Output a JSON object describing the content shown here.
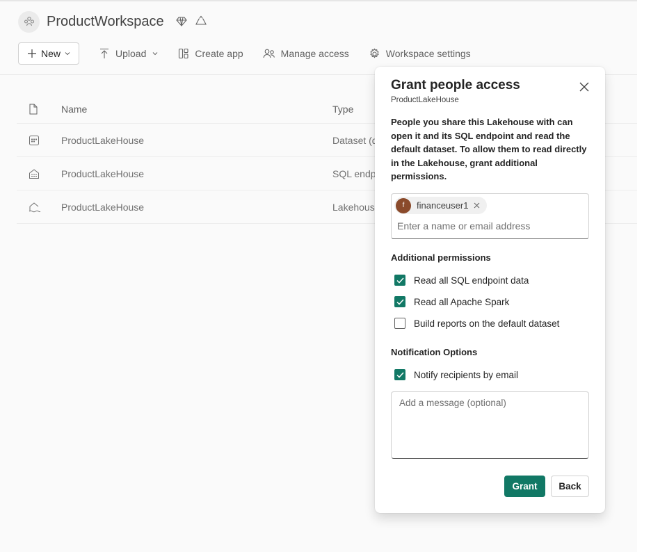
{
  "workspace": {
    "title": "ProductWorkspace",
    "icons": [
      "workspace-avatar-icon",
      "premium-diamond-icon",
      "recycle-icon"
    ]
  },
  "toolbar": {
    "new_label": "New",
    "upload_label": "Upload",
    "create_app_label": "Create app",
    "manage_access_label": "Manage access",
    "workspace_settings_label": "Workspace settings"
  },
  "table": {
    "columns": {
      "name": "Name",
      "type": "Type"
    },
    "rows": [
      {
        "icon": "dataset-icon",
        "name": "ProductLakeHouse",
        "type": "Dataset (d"
      },
      {
        "icon": "sql-endpoint-icon",
        "name": "ProductLakeHouse",
        "type": "SQL endpo"
      },
      {
        "icon": "lakehouse-icon",
        "name": "ProductLakeHouse",
        "type": "Lakehouse"
      }
    ]
  },
  "dialog": {
    "title": "Grant people access",
    "subtitle": "ProductLakeHouse",
    "description": "People you share this Lakehouse with can open it and its SQL endpoint and read the default dataset. To allow them to read directly in the Lakehouse, grant additional permissions.",
    "recipient": {
      "initial": "f",
      "name": "financeuser1"
    },
    "people_placeholder": "Enter a name or email address",
    "additional_permissions_label": "Additional permissions",
    "permissions": [
      {
        "label": "Read all SQL endpoint data",
        "checked": true
      },
      {
        "label": "Read all Apache Spark",
        "checked": true
      },
      {
        "label": "Build reports on the default dataset",
        "checked": false
      }
    ],
    "notification_label": "Notification Options",
    "notify": {
      "label": "Notify recipients by email",
      "checked": true
    },
    "message_placeholder": "Add a message (optional)",
    "grant_label": "Grant",
    "back_label": "Back"
  },
  "colors": {
    "accent": "#117865",
    "chip_avatar": "#8a4a2b"
  }
}
